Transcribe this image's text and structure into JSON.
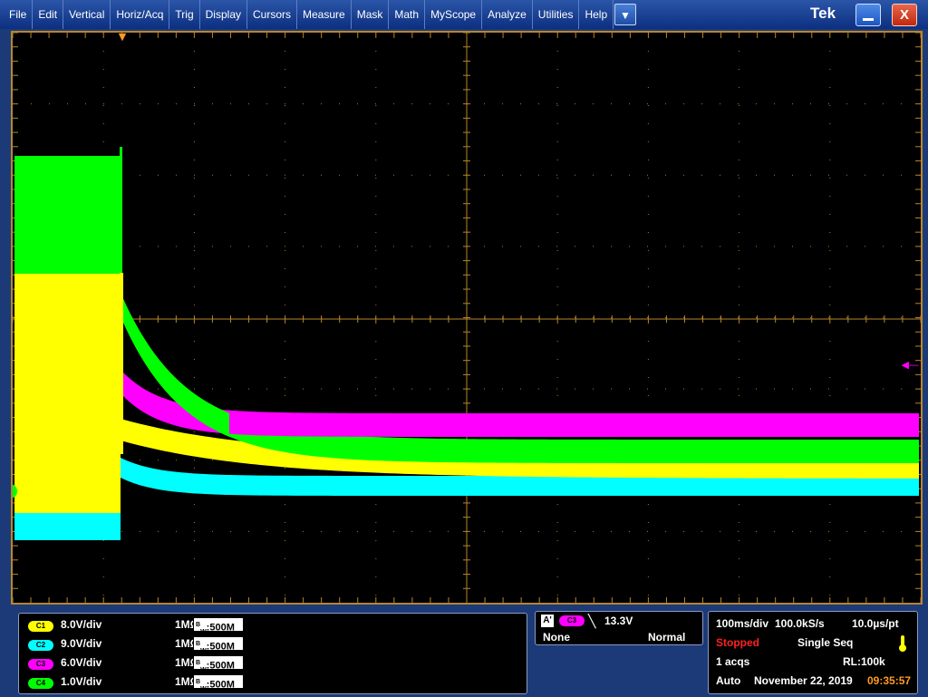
{
  "menubar": {
    "items": [
      "File",
      "Edit",
      "Vertical",
      "Horiz/Acq",
      "Trig",
      "Display",
      "Cursors",
      "Measure",
      "Mask",
      "Math",
      "MyScope",
      "Analyze",
      "Utilities",
      "Help"
    ],
    "more_glyph": "▼",
    "logo": "Tek",
    "close_glyph": "X"
  },
  "colors": {
    "ch1": "#ffff00",
    "ch2": "#00ffff",
    "ch3": "#ff00ff",
    "ch4": "#00ff00",
    "graticule": "#b8862b"
  },
  "display": {
    "ground_marker_label": "4",
    "trigger_position_marker": "▼",
    "trigger_level_marker": "◀"
  },
  "channels": [
    {
      "badge": "C1",
      "scale": "8.0V/div",
      "impedance": "1MΩ",
      "bandwidth": "500M"
    },
    {
      "badge": "C2",
      "scale": "9.0V/div",
      "impedance": "1MΩ",
      "bandwidth": "500M"
    },
    {
      "badge": "C3",
      "scale": "6.0V/div",
      "impedance": "1MΩ",
      "bandwidth": "500M"
    },
    {
      "badge": "C4",
      "scale": "1.0V/div",
      "impedance": "1MΩ",
      "bandwidth": "500M"
    }
  ],
  "trigger": {
    "label": "A'",
    "source": "C3",
    "slope_glyph": "╲",
    "level": "13.3V",
    "coupling": "None",
    "mode": "Normal"
  },
  "acquisition": {
    "timebase": "100ms/div",
    "sample_rate": "100.0kS/s",
    "resolution": "10.0µs/pt",
    "status": "Stopped",
    "sequence": "Single Seq",
    "acqs": "1 acqs",
    "record_length": "RL:100k",
    "trigger_mode": "Auto",
    "date": "November 22, 2019",
    "time": "09:35:57"
  }
}
